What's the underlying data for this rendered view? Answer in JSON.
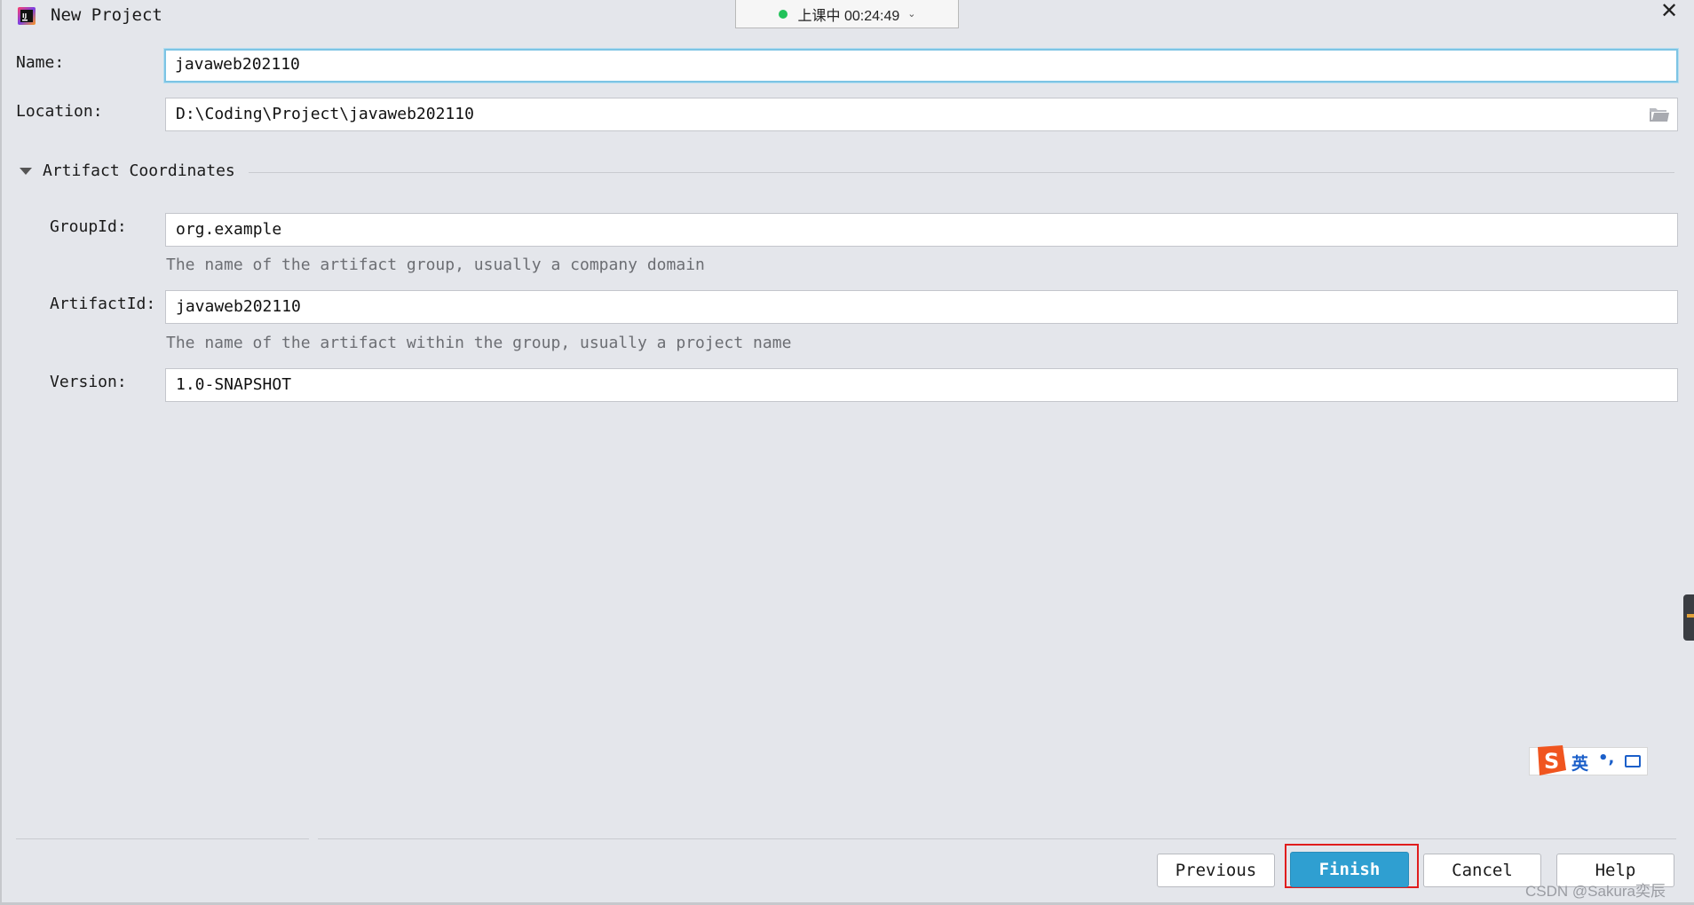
{
  "window": {
    "title": "New Project",
    "close_icon": "close-icon",
    "app_icon": "intellij-idea-icon"
  },
  "recording": {
    "status_text": "上课中 00:24:49",
    "indicator_color": "#22c25a",
    "chevron": "chevron-down-icon"
  },
  "form": {
    "name": {
      "label": "Name:",
      "value": "javaweb202110"
    },
    "location": {
      "label": "Location:",
      "value": "D:\\Coding\\Project\\javaweb202110",
      "icon": "folder-icon"
    },
    "artifact_section": {
      "title": "Artifact Coordinates",
      "expanded": true,
      "group_id": {
        "label": "GroupId:",
        "value": "org.example",
        "hint": "The name of the artifact group, usually a company domain"
      },
      "artifact_id": {
        "label": "ArtifactId:",
        "value": "javaweb202110",
        "hint": "The name of the artifact within the group, usually a project name"
      },
      "version": {
        "label": "Version:",
        "value": "1.0-SNAPSHOT"
      }
    }
  },
  "buttons": {
    "previous": "Previous",
    "finish": "Finish",
    "cancel": "Cancel",
    "help": "Help"
  },
  "ime": {
    "language": "英",
    "punctuation": "•,",
    "keyboard_icon": "keyboard-icon",
    "logo_icon": "sogou-logo-icon"
  },
  "watermark": "CSDN @Sakura奕辰",
  "colors": {
    "background": "#e4e6eb",
    "primary_button": "#2f9fd1",
    "focus_border": "#7dc4e4",
    "highlight": "#e01d1d",
    "hint_text": "#6c6e73"
  }
}
